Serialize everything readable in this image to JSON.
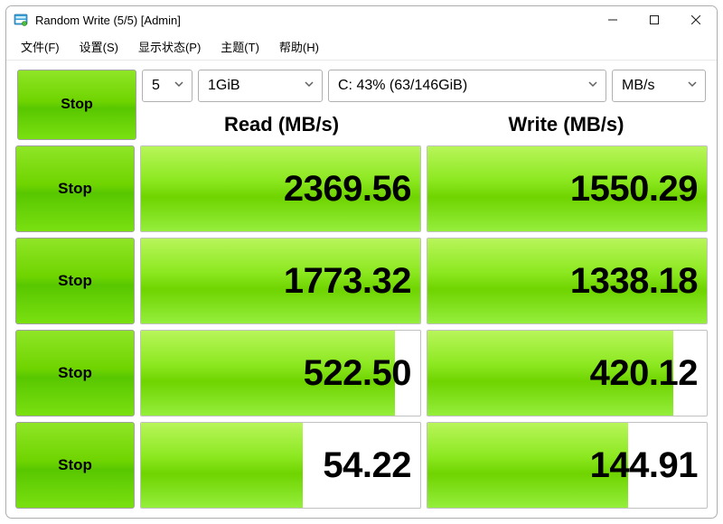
{
  "window": {
    "title": "Random Write (5/5) [Admin]"
  },
  "menu": {
    "file": "文件(F)",
    "settings": "设置(S)",
    "display": "显示状态(P)",
    "theme": "主题(T)",
    "help": "帮助(H)"
  },
  "controls": {
    "main_button": "Stop",
    "loops": "5",
    "size": "1GiB",
    "drive": "C: 43% (63/146GiB)",
    "unit": "MB/s"
  },
  "headers": {
    "read": "Read (MB/s)",
    "write": "Write (MB/s)"
  },
  "rows": [
    {
      "label": "Stop",
      "read": "2369.56",
      "read_fill": 100,
      "write": "1550.29",
      "write_fill": 100
    },
    {
      "label": "Stop",
      "read": "1773.32",
      "read_fill": 100,
      "write": "1338.18",
      "write_fill": 100
    },
    {
      "label": "Stop",
      "read": "522.50",
      "read_fill": 91,
      "write": "420.12",
      "write_fill": 88
    },
    {
      "label": "Stop",
      "read": "54.22",
      "read_fill": 58,
      "write": "144.91",
      "write_fill": 72
    }
  ],
  "chart_data": {
    "type": "table",
    "title": "Random Write (5/5)",
    "columns": [
      "Read (MB/s)",
      "Write (MB/s)"
    ],
    "rows": [
      {
        "read": 2369.56,
        "write": 1550.29
      },
      {
        "read": 1773.32,
        "write": 1338.18
      },
      {
        "read": 522.5,
        "write": 420.12
      },
      {
        "read": 54.22,
        "write": 144.91
      }
    ]
  }
}
